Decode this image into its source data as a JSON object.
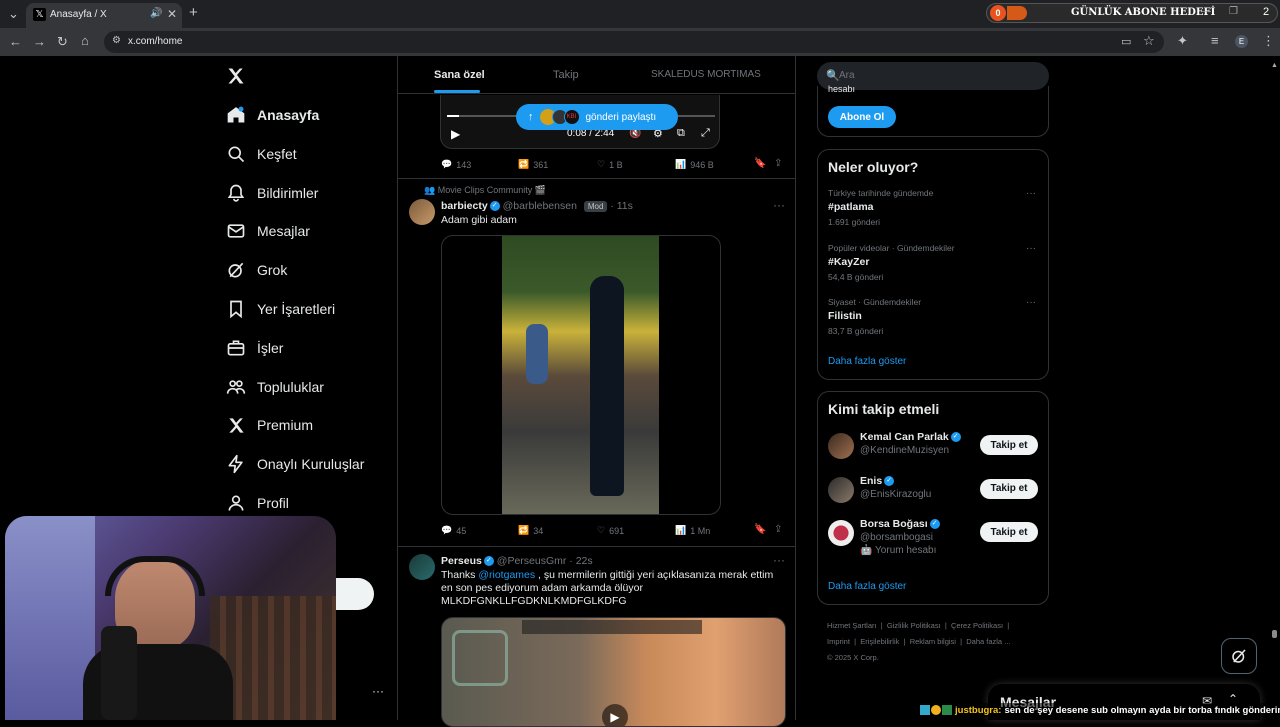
{
  "browser": {
    "tab_title": "Anasayfa / X",
    "url": "x.com/home",
    "overlay_goal_count": "0",
    "overlay_goal_label": "GÜNLÜK ABONE HEDEFİ",
    "overlay_goal_target": "2"
  },
  "sidebar": {
    "items": [
      {
        "label": "Anasayfa",
        "icon": "home-icon"
      },
      {
        "label": "Keşfet",
        "icon": "search-icon"
      },
      {
        "label": "Bildirimler",
        "icon": "bell-icon"
      },
      {
        "label": "Mesajlar",
        "icon": "mail-icon"
      },
      {
        "label": "Grok",
        "icon": "grok-icon"
      },
      {
        "label": "Yer İşaretleri",
        "icon": "bookmark-icon"
      },
      {
        "label": "İşler",
        "icon": "briefcase-icon"
      },
      {
        "label": "Topluluklar",
        "icon": "communities-icon"
      },
      {
        "label": "Premium",
        "icon": "x-logo-icon"
      },
      {
        "label": "Onaylı Kuruluşlar",
        "icon": "lightning-icon"
      },
      {
        "label": "Profil",
        "icon": "person-icon"
      }
    ],
    "more": "···"
  },
  "feed": {
    "tabs": [
      "Sana özel",
      "Takip",
      "SKALEDUS MORTIMAS"
    ],
    "repost_banner": "gönderi paylaştı",
    "video_time": "0:08 / 2:44",
    "tweet0_stats": {
      "replies": "143",
      "reposts": "361",
      "likes": "1 B",
      "views": "946 B"
    },
    "tweet1": {
      "community": "Movie Clips Community 🎬",
      "name": "barbiecty",
      "handle": "@barblebensen",
      "badge": "Mod",
      "time": "· 11s",
      "text": "Adam gibi adam",
      "replies": "45",
      "reposts": "34",
      "likes": "691",
      "views": "1 Mn"
    },
    "tweet2": {
      "name": "Perseus",
      "handle": "@PerseusGmr · 22s",
      "text_before": "Thanks ",
      "mention": "@riotgames",
      "text_after": " , şu mermilerin gittiği yeri açıklasanıza merak ettim en son pes ediyorum adam arkamda ölüyor MLKDFGNKLLFGDKNLKMDFGLKDFG"
    }
  },
  "right": {
    "search_placeholder": "Ara",
    "subscribe_top": "hesabı",
    "subscribe_button": "Abone Ol",
    "trends_title": "Neler oluyor?",
    "trends": [
      {
        "context": "Türkiye tarihinde gündemde",
        "name": "#patlama",
        "count": "1.691 gönderi"
      },
      {
        "context": "Popüler videolar · Gündemdekiler",
        "name": "#KayZer",
        "count": "54,4 B gönderi"
      },
      {
        "context": "Siyaset · Gündemdekiler",
        "name": "Filistin",
        "count": "83,7 B gönderi"
      }
    ],
    "trends_more": "Daha fazla göster",
    "who_title": "Kimi takip etmeli",
    "who": [
      {
        "name": "Kemal Can Parlak",
        "handle": "@KendineMuzisyen",
        "extra": ""
      },
      {
        "name": "Enis",
        "handle": "@EnisKirazoglu",
        "extra": ""
      },
      {
        "name": "Borsa Boğası",
        "handle": "@borsambogasi",
        "extra": "🤖 Yorum hesabı"
      }
    ],
    "follow_label": "Takip et",
    "who_more": "Daha fazla göster",
    "footer": [
      "Hizmet Şartları",
      "Gizlilik Politikası",
      "Çerez Politikası",
      "Imprint",
      "Erişilebilirlik",
      "Reklam bilgisi",
      "Daha fazla ..."
    ],
    "copyright": "© 2025 X Corp.",
    "messages": "Mesajlar"
  },
  "stream": {
    "chat_user": "justbugra:",
    "chat_message": "sen de şey desene sub olmayın ayda bir torba fındık gönderin"
  }
}
